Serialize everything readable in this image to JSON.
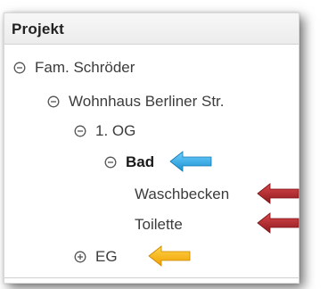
{
  "panel": {
    "title": "Projekt"
  },
  "tree": {
    "family": {
      "label": "Fam. Schröder",
      "state": "expanded"
    },
    "house": {
      "label": "Wohnhaus Berliner Str.",
      "state": "expanded"
    },
    "floor1": {
      "label": "1. OG",
      "state": "expanded"
    },
    "bad": {
      "label": "Bad",
      "state": "expanded",
      "selected": true
    },
    "waschbecken": {
      "label": "Waschbecken"
    },
    "toilette": {
      "label": "Toilette"
    },
    "eg": {
      "label": "EG",
      "state": "collapsed"
    }
  },
  "annotations": {
    "arrow_blue_color": "#1fa7e6",
    "arrow_red_color": "#b3262a",
    "arrow_yellow_color": "#f5b400"
  }
}
